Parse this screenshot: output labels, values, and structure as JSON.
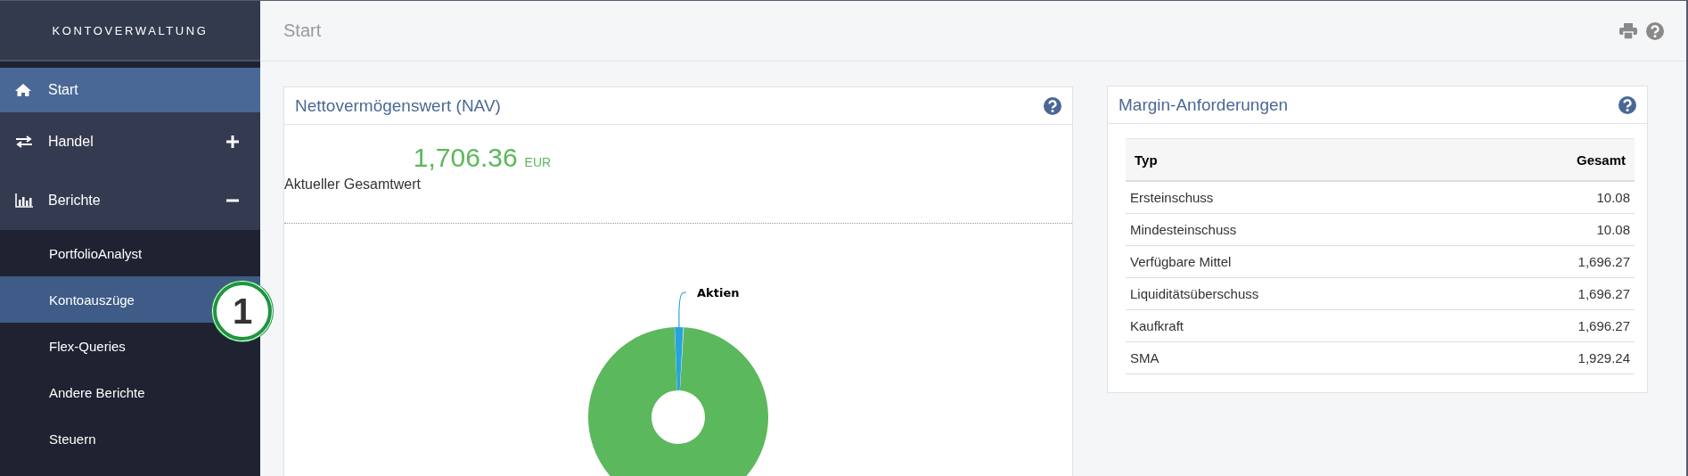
{
  "sidebar": {
    "title": "KONTOVERWALTUNG",
    "items": [
      {
        "label": "Start",
        "selected": true
      },
      {
        "label": "Handel",
        "selected": false,
        "expanded": false
      },
      {
        "label": "Berichte",
        "selected": false,
        "expanded": true,
        "children": [
          {
            "label": "PortfolioAnalyst",
            "selected": false
          },
          {
            "label": "Kontoauszüge",
            "selected": true
          },
          {
            "label": "Flex-Queries",
            "selected": false
          },
          {
            "label": "Andere Berichte",
            "selected": false
          },
          {
            "label": "Steuern",
            "selected": false
          }
        ]
      }
    ]
  },
  "annotation": {
    "label": "1"
  },
  "header": {
    "title": "Start"
  },
  "nav_panel": {
    "title": "Nettovermögenswert (NAV)",
    "value": "1,706.36",
    "currency": "EUR",
    "caption": "Aktueller Gesamtwert",
    "chart_label": "Aktien"
  },
  "margin_panel": {
    "title": "Margin-Anforderungen",
    "table": {
      "columns": [
        "Typ",
        "Gesamt"
      ],
      "rows": [
        [
          "Ersteinschuss",
          "10.08"
        ],
        [
          "Mindesteinschuss",
          "10.08"
        ],
        [
          "Verfügbare Mittel",
          "1,696.27"
        ],
        [
          "Liquiditätsüberschuss",
          "1,696.27"
        ],
        [
          "Kaufkraft",
          "1,696.27"
        ],
        [
          "SMA",
          "1,929.24"
        ]
      ]
    }
  }
}
